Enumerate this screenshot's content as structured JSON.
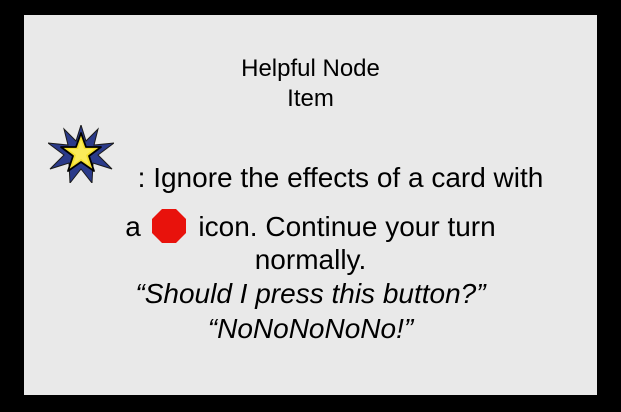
{
  "card": {
    "title": "Helpful Node",
    "type": "Item",
    "effect_prefix": ": Ignore the effects of a card with",
    "effect_a": "a",
    "effect_suffix": "icon.  Continue your turn",
    "effect_end": "normally.",
    "quote1": "“Should I press this button?”",
    "quote2": "“NoNoNoNoNo!”",
    "icons": {
      "trigger": "star-icon",
      "condition": "stop-sign-icon"
    },
    "colors": {
      "background": "#e9e9e9",
      "border": "#000000",
      "stop_icon": "#e8120c",
      "star_fill": "#f4df2c",
      "star_burst": "#2a3a8a"
    }
  }
}
